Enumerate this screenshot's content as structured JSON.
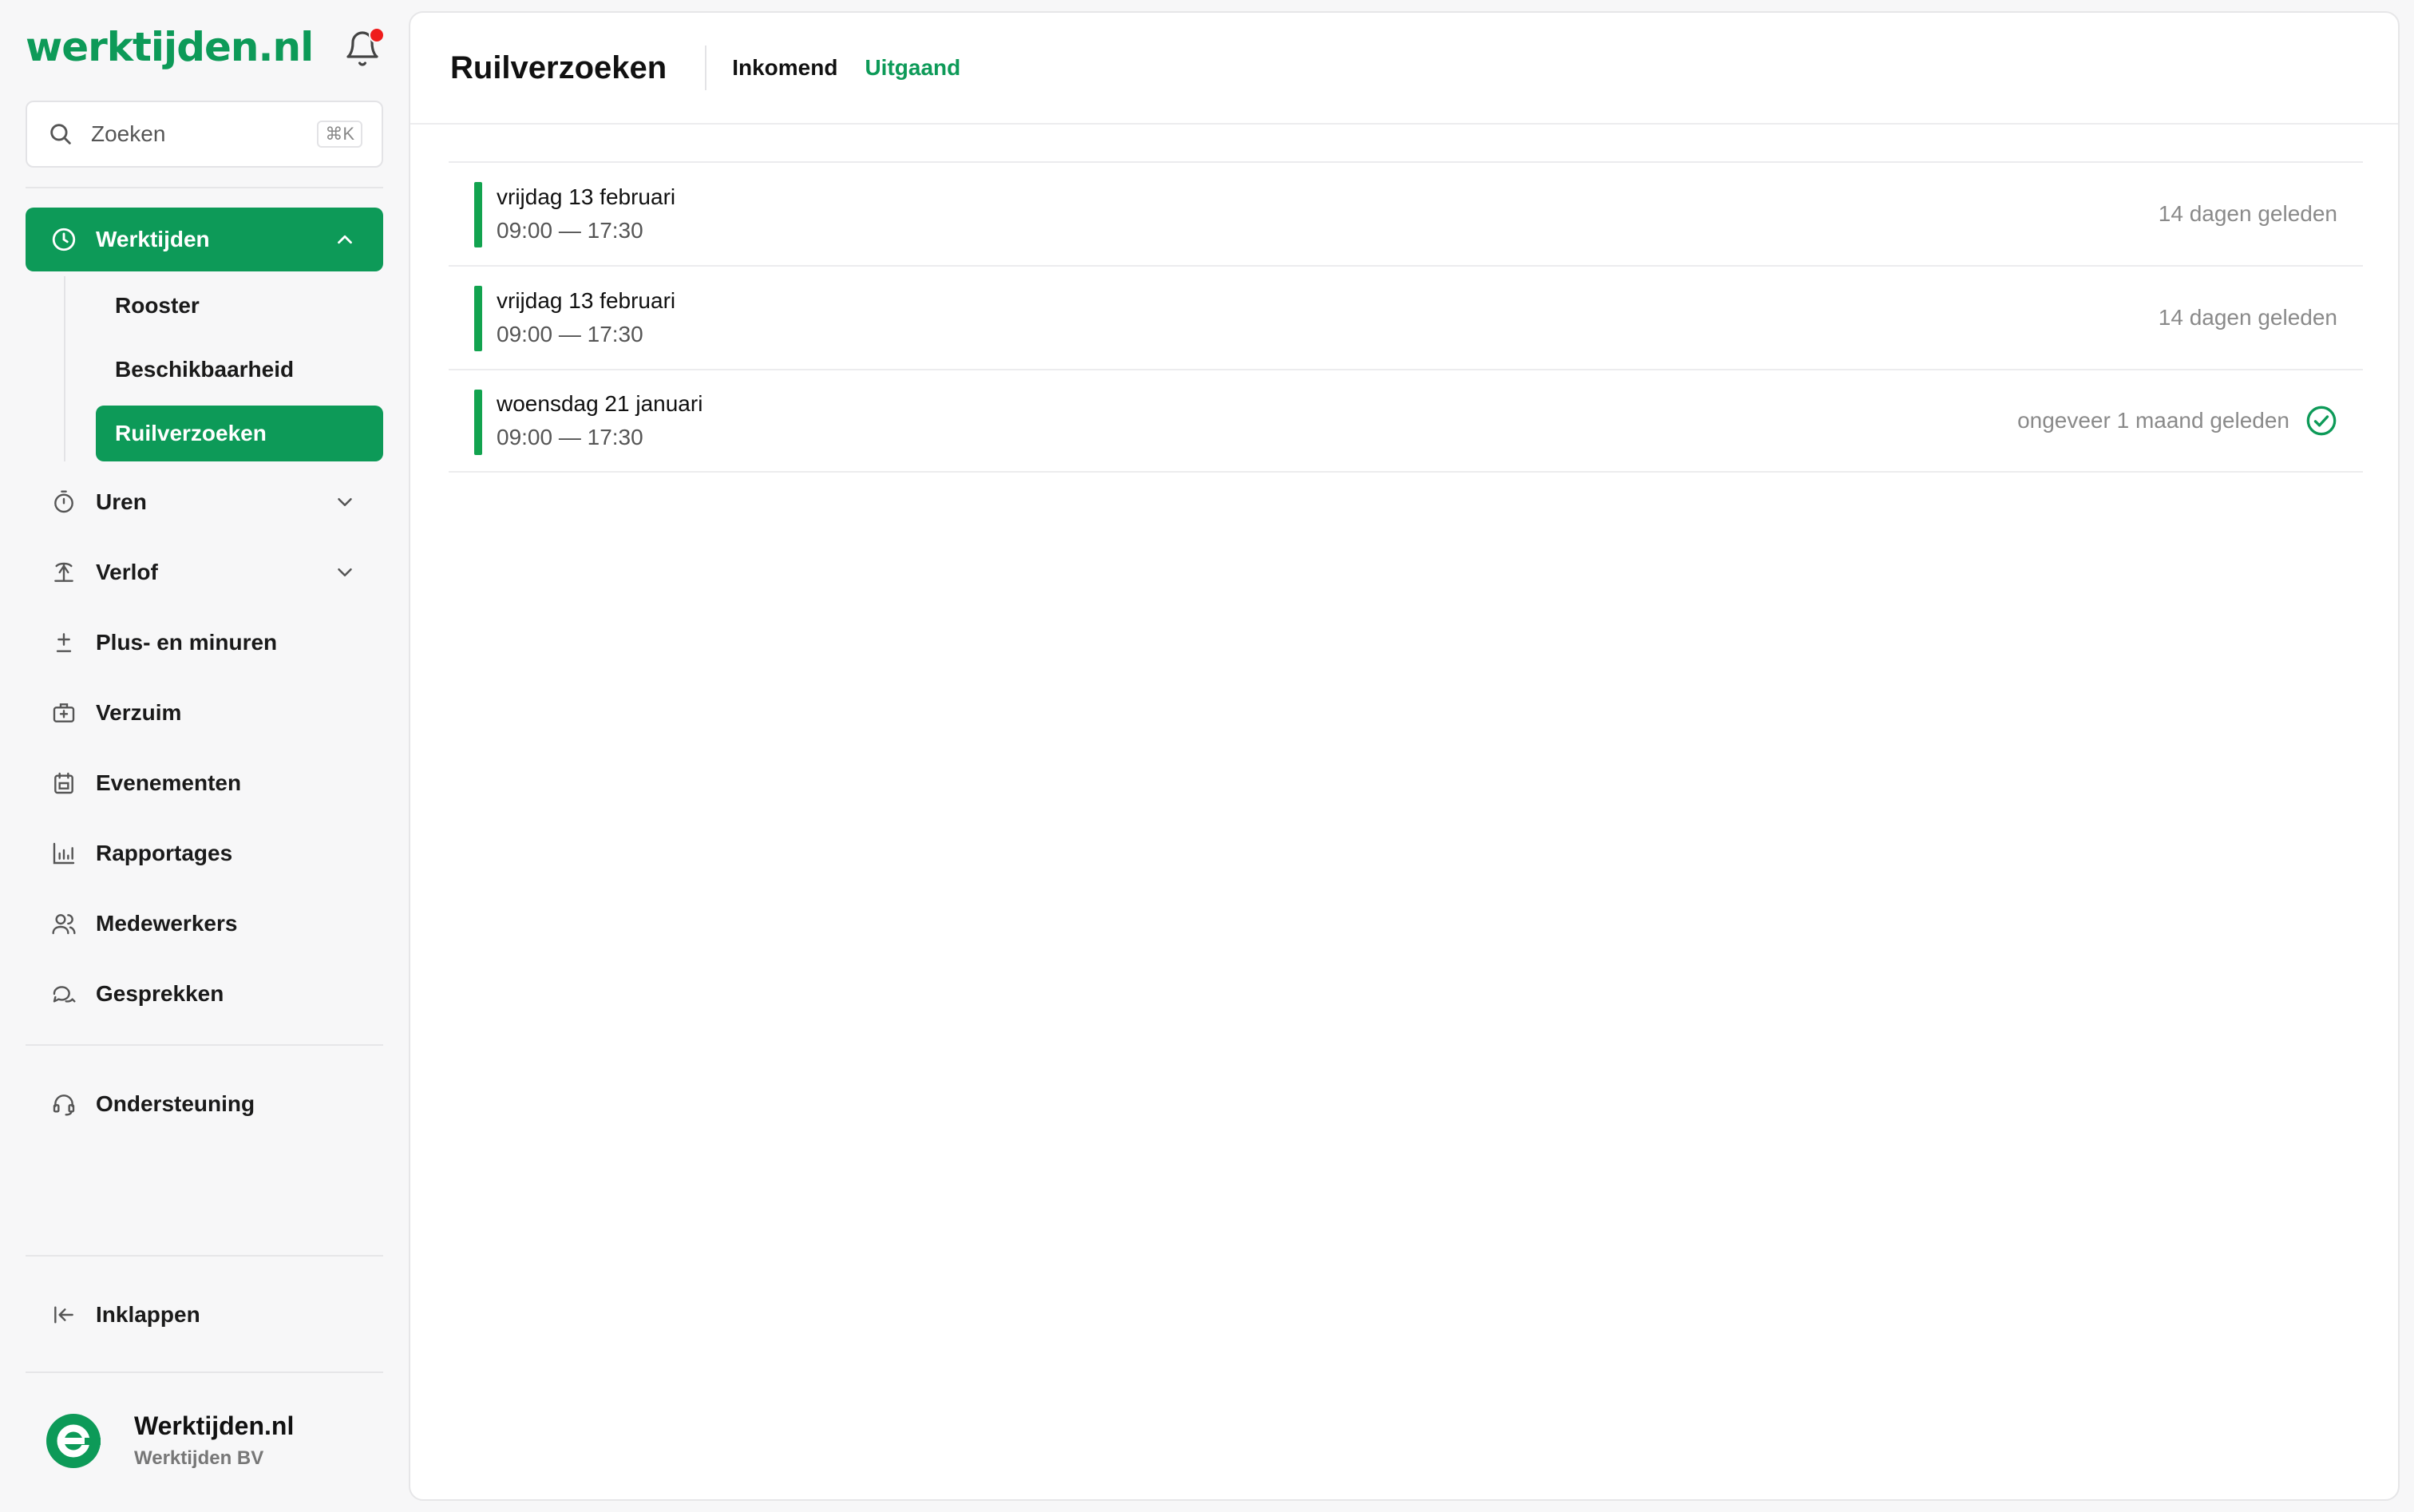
{
  "brand": {
    "logo_text": "werktijden.nl",
    "accent": "#0d9a58"
  },
  "search": {
    "placeholder": "Zoeken",
    "shortcut": "⌘K"
  },
  "sidebar": {
    "main_item": {
      "label": "Werktijden",
      "icon": "clock-icon"
    },
    "sub_items": [
      {
        "label": "Rooster"
      },
      {
        "label": "Beschikbaarheid"
      },
      {
        "label": "Ruilverzoeken"
      }
    ],
    "items": [
      {
        "label": "Uren",
        "icon": "stopwatch-icon"
      },
      {
        "label": "Verlof",
        "icon": "palm-icon"
      },
      {
        "label": "Plus- en minuren",
        "icon": "plus-minus-icon"
      },
      {
        "label": "Verzuim",
        "icon": "medical-kit-icon"
      },
      {
        "label": "Evenementen",
        "icon": "calendar-icon"
      },
      {
        "label": "Rapportages",
        "icon": "bar-chart-icon"
      },
      {
        "label": "Medewerkers",
        "icon": "users-icon"
      },
      {
        "label": "Gesprekken",
        "icon": "chat-icon"
      }
    ],
    "support": {
      "label": "Ondersteuning",
      "icon": "headset-icon"
    },
    "collapse": {
      "label": "Inklappen",
      "icon": "collapse-icon"
    }
  },
  "organization": {
    "name": "Werktijden.nl",
    "company": "Werktijden BV"
  },
  "page": {
    "title": "Ruilverzoeken",
    "tabs": [
      {
        "label": "Inkomend"
      },
      {
        "label": "Uitgaand"
      }
    ]
  },
  "requests": [
    {
      "date": "vrijdag 13 februari",
      "time": "09:00 — 17:30",
      "ago": "14 dagen geleden",
      "approved": false
    },
    {
      "date": "vrijdag 13 februari",
      "time": "09:00 — 17:30",
      "ago": "14 dagen geleden",
      "approved": false
    },
    {
      "date": "woensdag 21 januari",
      "time": "09:00 — 17:30",
      "ago": "ongeveer 1 maand geleden",
      "approved": true
    }
  ]
}
